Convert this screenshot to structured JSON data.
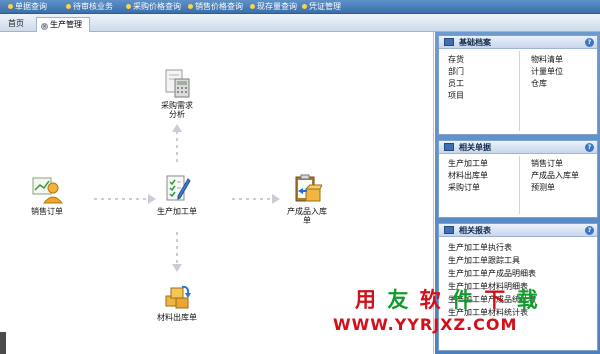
{
  "menu": [
    {
      "label": "单据查询"
    },
    {
      "label": "待审核业务"
    },
    {
      "label": "采购价格查询"
    },
    {
      "label": "销售价格查询"
    },
    {
      "label": "现存量查询"
    },
    {
      "label": "凭证管理"
    }
  ],
  "tabs": {
    "home": "首页",
    "active": "生产管理",
    "close_glyph": "×"
  },
  "flow": {
    "sales_order": "销售订单",
    "purchase_demand": "采购需求分析",
    "production_order": "生产加工单",
    "finished_goods_in": "产成品入库单",
    "material_out": "材料出库单"
  },
  "panels": {
    "basic": {
      "title": "基础档案",
      "help": "?",
      "left": [
        "存货",
        "部门",
        "员工",
        "项目"
      ],
      "right": [
        "物料清单",
        "计量单位",
        "仓库"
      ]
    },
    "docs": {
      "title": "相关单据",
      "help": "?",
      "left": [
        "生产加工单",
        "材料出库单",
        "采购订单"
      ],
      "right": [
        "销售订单",
        "产成品入库单",
        "预测单"
      ]
    },
    "reports": {
      "title": "相关报表",
      "help": "?",
      "items": [
        "生产加工单执行表",
        "生产加工单跟踪工具",
        "生产加工单产成品明细表",
        "生产加工单材料明细表",
        "生产加工单产成品统计表",
        "生产加工单材料统计表"
      ]
    }
  },
  "watermark": {
    "line1_a": "用",
    "line1_b": "友",
    "line1_c": "软",
    "line1_d": "件",
    "line1_e": "下",
    "line1_f": "载",
    "line2": "WWW.YYRJXZ.COM"
  },
  "colors": {
    "menu_bar": "#3b6fab",
    "sidebar": "#4c7fbe",
    "watermark_red": "#d3101a",
    "watermark_green": "#139a2d"
  },
  "icons": {
    "sales_order": "user-chart-icon",
    "purchase_demand": "calculator-document-icon",
    "production_order": "checklist-pencil-icon",
    "finished_goods_in": "clipboard-box-icon",
    "material_out": "boxes-arrow-icon"
  }
}
